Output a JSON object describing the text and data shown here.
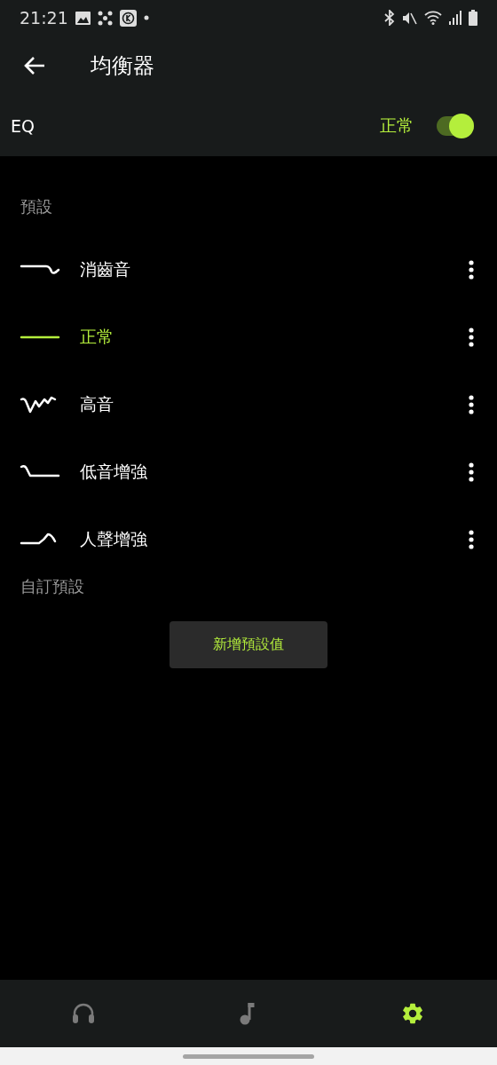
{
  "status_bar": {
    "time": "21:21"
  },
  "app_bar": {
    "title": "均衡器"
  },
  "eq": {
    "label": "EQ",
    "preset": "正常",
    "on": true
  },
  "presets_section": {
    "title": "預設"
  },
  "presets": [
    {
      "label": "消齒音",
      "kind": "deesser",
      "selected": false
    },
    {
      "label": "正常",
      "kind": "flat",
      "selected": true
    },
    {
      "label": "高音",
      "kind": "treble",
      "selected": false
    },
    {
      "label": "低音增強",
      "kind": "bass",
      "selected": false
    },
    {
      "label": "人聲增強",
      "kind": "vocal",
      "selected": false
    }
  ],
  "custom_section": {
    "title": "自訂預設",
    "button": "新增預設值"
  },
  "bottom_nav": [
    {
      "kind": "headphones",
      "selected": false
    },
    {
      "kind": "music",
      "selected": false
    },
    {
      "kind": "settings",
      "selected": true
    }
  ]
}
